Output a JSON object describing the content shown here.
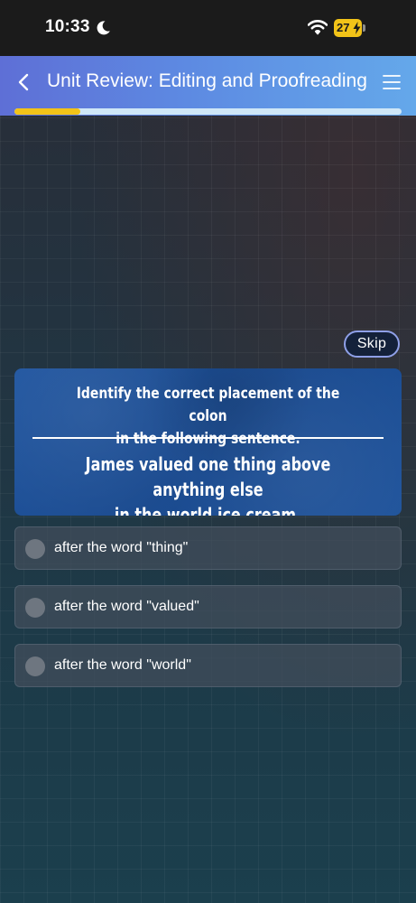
{
  "status_bar": {
    "time": "10:33",
    "battery_level": "27"
  },
  "header": {
    "title": "Unit Review: Editing and Proofreading",
    "progress_fraction": 0.17
  },
  "skip_label": "Skip",
  "question": {
    "prompt_line1": "Identify the correct placement of the colon",
    "prompt_line2": "in the following sentence.",
    "sentence_line1": "James valued one thing above anything else",
    "sentence_line2": "in the world ice cream."
  },
  "options": [
    {
      "label": "after the word \"thing\""
    },
    {
      "label": "after the word \"valued\""
    },
    {
      "label": "after the word \"world\""
    }
  ],
  "colors": {
    "accent_yellow": "#f2c318",
    "header_start": "#5e6fd6",
    "header_end": "#64a8ea",
    "card_blue": "#1d4f93"
  }
}
